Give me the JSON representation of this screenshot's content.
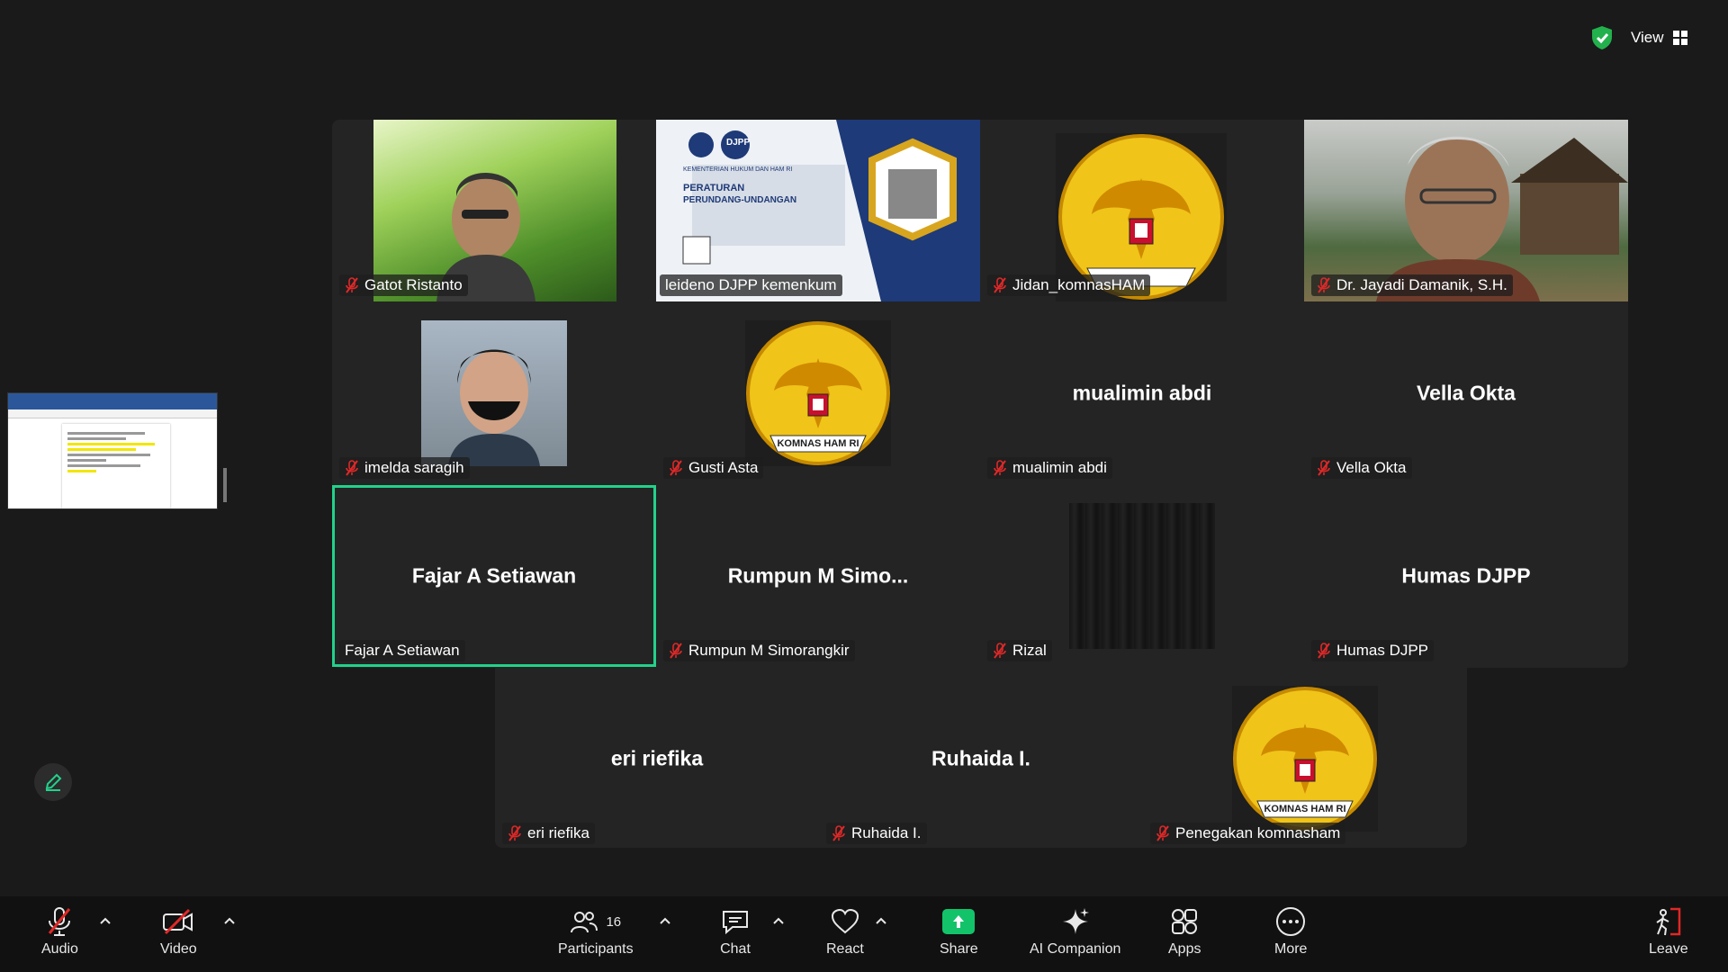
{
  "header": {
    "view_label": "View"
  },
  "tiles": {
    "gatot": {
      "label": "Gatot Ristanto"
    },
    "leideno": {
      "label": "leideno DJPP kemenkum"
    },
    "jidan": {
      "label": "Jidan_komnasHAM"
    },
    "jayadi": {
      "label": "Dr. Jayadi Damanik, S.H."
    },
    "imelda": {
      "label": "imelda saragih"
    },
    "gusti": {
      "label": "Gusti Asta"
    },
    "mualimin": {
      "label": "mualimin abdi",
      "name": "mualimin abdi"
    },
    "vella": {
      "label": "Vella Okta",
      "name": "Vella Okta"
    },
    "fajar": {
      "label": "Fajar A Setiawan",
      "name": "Fajar A Setiawan"
    },
    "rumpun": {
      "label": "Rumpun M Simorangkir",
      "name": "Rumpun  M  Simo..."
    },
    "rizal": {
      "label": "Rizal"
    },
    "humas": {
      "label": "Humas DJPP",
      "name": "Humas DJPP"
    },
    "eri": {
      "label": "eri riefika",
      "name": "eri riefika"
    },
    "ruhaida": {
      "label": "Ruhaida I.",
      "name": "Ruhaida I."
    },
    "penegakan": {
      "label": "Penegakan komnasham"
    }
  },
  "emblem_text": "KOMNAS HAM RI",
  "djpp_slide": {
    "badge": "DJPP",
    "line1": "KEMENTERIAN HUKUM DAN HAM RI",
    "line2": "PERATURAN",
    "line3": "PERUNDANG-UNDANGAN"
  },
  "toolbar": {
    "audio": "Audio",
    "video": "Video",
    "participants": "Participants",
    "participants_count": "16",
    "chat": "Chat",
    "react": "React",
    "share": "Share",
    "ai_companion": "AI Companion",
    "apps": "Apps",
    "more": "More",
    "leave": "Leave"
  },
  "colors": {
    "active_border": "#23d18b",
    "muted_mic": "#e02828",
    "share_green": "#13c36a"
  }
}
